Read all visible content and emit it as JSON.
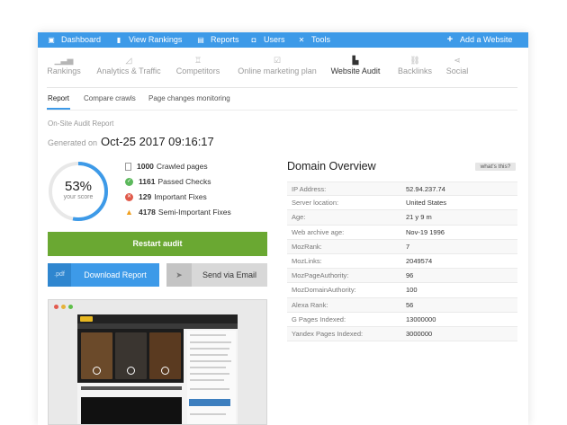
{
  "topbar": {
    "items": [
      {
        "label": "Dashboard",
        "icon": "dashboard-icon"
      },
      {
        "label": "View Rankings",
        "icon": "bar-chart-icon"
      },
      {
        "label": "Reports",
        "icon": "report-icon"
      },
      {
        "label": "Users",
        "icon": "lock-icon"
      },
      {
        "label": "Tools",
        "icon": "tools-icon"
      }
    ],
    "add_website": "Add a Website"
  },
  "nav": {
    "items": [
      {
        "label": "Rankings",
        "icon": "bar-chart-icon"
      },
      {
        "label": "Analytics & Traffic",
        "icon": "area-chart-icon"
      },
      {
        "label": "Competitors",
        "icon": "trophy-icon"
      },
      {
        "label": "Online marketing plan",
        "icon": "checklist-icon"
      },
      {
        "label": "Website Audit",
        "icon": "audit-icon"
      },
      {
        "label": "Backlinks",
        "icon": "link-icon"
      },
      {
        "label": "Social",
        "icon": "share-icon"
      }
    ],
    "active": "Website Audit"
  },
  "subtabs": [
    "Report",
    "Compare crawls",
    "Page changes monitoring"
  ],
  "report": {
    "heading": "On-Site Audit Report",
    "generated_label": "Generated on",
    "generated_date": "Oct-25 2017 09:16:17",
    "score_value": "53%",
    "score_label": "your score",
    "score_fraction": 0.53
  },
  "stats": [
    {
      "count": "1000",
      "label": "Crawled pages",
      "icon": "page-icon",
      "color": "#cccccc"
    },
    {
      "count": "1161",
      "label": "Passed Checks",
      "icon": "check-icon",
      "color": "#5cb85c"
    },
    {
      "count": "129",
      "label": "Important Fixes",
      "icon": "error-icon",
      "color": "#e05a4a"
    },
    {
      "count": "4178",
      "label": "Semi-Important Fixes",
      "icon": "warning-icon",
      "color": "#f0a020"
    }
  ],
  "buttons": {
    "restart": "Restart audit",
    "pdf": ".pdf",
    "download": "Download Report",
    "email": "Send via Email"
  },
  "domain": {
    "title": "Domain Overview",
    "whats_this": "what's this?",
    "rows": [
      {
        "key": "IP Address:",
        "value": "52.94.237.74"
      },
      {
        "key": "Server location:",
        "value": "United States"
      },
      {
        "key": "Age:",
        "value": "21 y 9 m"
      },
      {
        "key": "Web archive age:",
        "value": "Nov-19 1996"
      },
      {
        "key": "MozRank:",
        "value": "7"
      },
      {
        "key": "MozLinks:",
        "value": "2049574"
      },
      {
        "key": "MozPageAuthority:",
        "value": "96"
      },
      {
        "key": "MozDomainAuthority:",
        "value": "100"
      },
      {
        "key": "Alexa Rank:",
        "value": "56"
      },
      {
        "key": "G Pages Indexed:",
        "value": "13000000"
      },
      {
        "key": "Yandex Pages Indexed:",
        "value": "3000000"
      }
    ]
  },
  "colors": {
    "accent": "#3d9ae8",
    "restart": "#6aa832"
  }
}
